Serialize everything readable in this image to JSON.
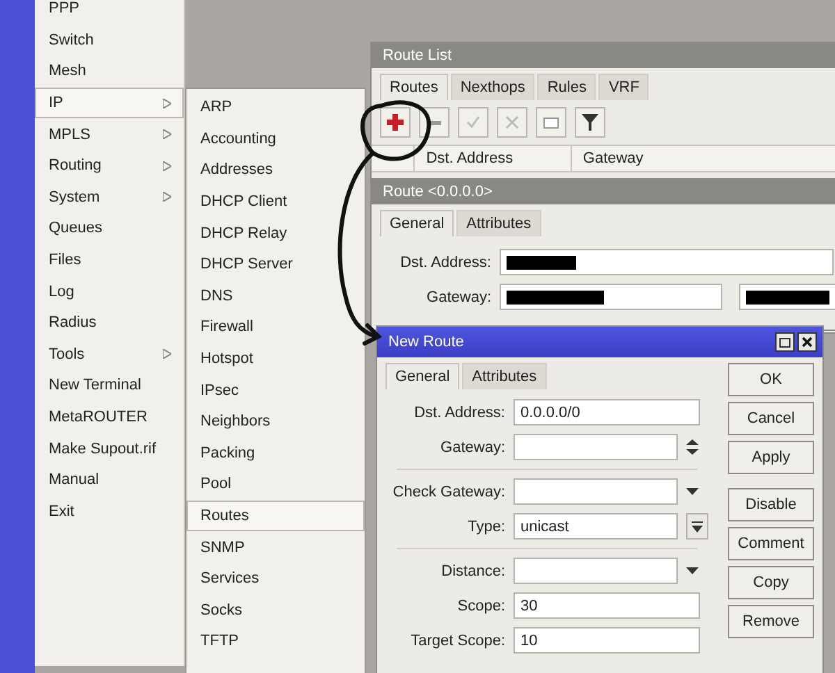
{
  "main_menu": {
    "items": [
      {
        "label": "PPP",
        "submenu": false,
        "selected": false
      },
      {
        "label": "Switch",
        "submenu": false,
        "selected": false
      },
      {
        "label": "Mesh",
        "submenu": false,
        "selected": false
      },
      {
        "label": "IP",
        "submenu": true,
        "selected": true
      },
      {
        "label": "MPLS",
        "submenu": true,
        "selected": false
      },
      {
        "label": "Routing",
        "submenu": true,
        "selected": false
      },
      {
        "label": "System",
        "submenu": true,
        "selected": false
      },
      {
        "label": "Queues",
        "submenu": false,
        "selected": false
      },
      {
        "label": "Files",
        "submenu": false,
        "selected": false
      },
      {
        "label": "Log",
        "submenu": false,
        "selected": false
      },
      {
        "label": "Radius",
        "submenu": false,
        "selected": false
      },
      {
        "label": "Tools",
        "submenu": true,
        "selected": false
      },
      {
        "label": "New Terminal",
        "submenu": false,
        "selected": false
      },
      {
        "label": "MetaROUTER",
        "submenu": false,
        "selected": false
      },
      {
        "label": "Make Supout.rif",
        "submenu": false,
        "selected": false
      },
      {
        "label": "Manual",
        "submenu": false,
        "selected": false
      },
      {
        "label": "Exit",
        "submenu": false,
        "selected": false
      }
    ]
  },
  "ip_submenu": {
    "items": [
      {
        "label": "ARP",
        "selected": false
      },
      {
        "label": "Accounting",
        "selected": false
      },
      {
        "label": "Addresses",
        "selected": false
      },
      {
        "label": "DHCP Client",
        "selected": false
      },
      {
        "label": "DHCP Relay",
        "selected": false
      },
      {
        "label": "DHCP Server",
        "selected": false
      },
      {
        "label": "DNS",
        "selected": false
      },
      {
        "label": "Firewall",
        "selected": false
      },
      {
        "label": "Hotspot",
        "selected": false
      },
      {
        "label": "IPsec",
        "selected": false
      },
      {
        "label": "Neighbors",
        "selected": false
      },
      {
        "label": "Packing",
        "selected": false
      },
      {
        "label": "Pool",
        "selected": false
      },
      {
        "label": "Routes",
        "selected": true
      },
      {
        "label": "SNMP",
        "selected": false
      },
      {
        "label": "Services",
        "selected": false
      },
      {
        "label": "Socks",
        "selected": false
      },
      {
        "label": "TFTP",
        "selected": false
      }
    ]
  },
  "route_list": {
    "title": "Route List",
    "tabs": [
      {
        "label": "Routes",
        "selected": true
      },
      {
        "label": "Nexthops",
        "selected": false
      },
      {
        "label": "Rules",
        "selected": false
      },
      {
        "label": "VRF",
        "selected": false
      }
    ],
    "toolbar": [
      {
        "kind": "add"
      },
      {
        "kind": "remove"
      },
      {
        "kind": "enable"
      },
      {
        "kind": "disable"
      },
      {
        "kind": "comment"
      },
      {
        "kind": "filter"
      }
    ],
    "columns": [
      "Dst. Address",
      "Gateway"
    ]
  },
  "route_window": {
    "title": "Route <0.0.0.0>",
    "tabs": [
      {
        "label": "General",
        "selected": true
      },
      {
        "label": "Attributes",
        "selected": false
      }
    ],
    "fields": [
      {
        "label": "Dst. Address:",
        "extra": false
      },
      {
        "label": "Gateway:",
        "extra": true
      }
    ]
  },
  "new_route": {
    "title": "New Route",
    "tabs": [
      {
        "label": "General",
        "selected": true
      },
      {
        "label": "Attributes",
        "selected": false
      }
    ],
    "groups": [
      [
        {
          "label": "Dst. Address:",
          "kind": "text",
          "value": "0.0.0.0/0"
        },
        {
          "label": "Gateway:",
          "kind": "updown"
        }
      ],
      [
        {
          "label": "Check Gateway:",
          "kind": "dropdown"
        },
        {
          "label": "Type:",
          "kind": "dropdown_box",
          "value": "unicast"
        }
      ],
      [
        {
          "label": "Distance:",
          "kind": "dropdown"
        },
        {
          "label": "Scope:",
          "kind": "text",
          "value": "30"
        },
        {
          "label": "Target Scope:",
          "kind": "text",
          "value": "10"
        }
      ]
    ],
    "buttons": [
      "OK",
      "Cancel",
      "Apply",
      "Disable",
      "Comment",
      "Copy",
      "Remove"
    ]
  }
}
